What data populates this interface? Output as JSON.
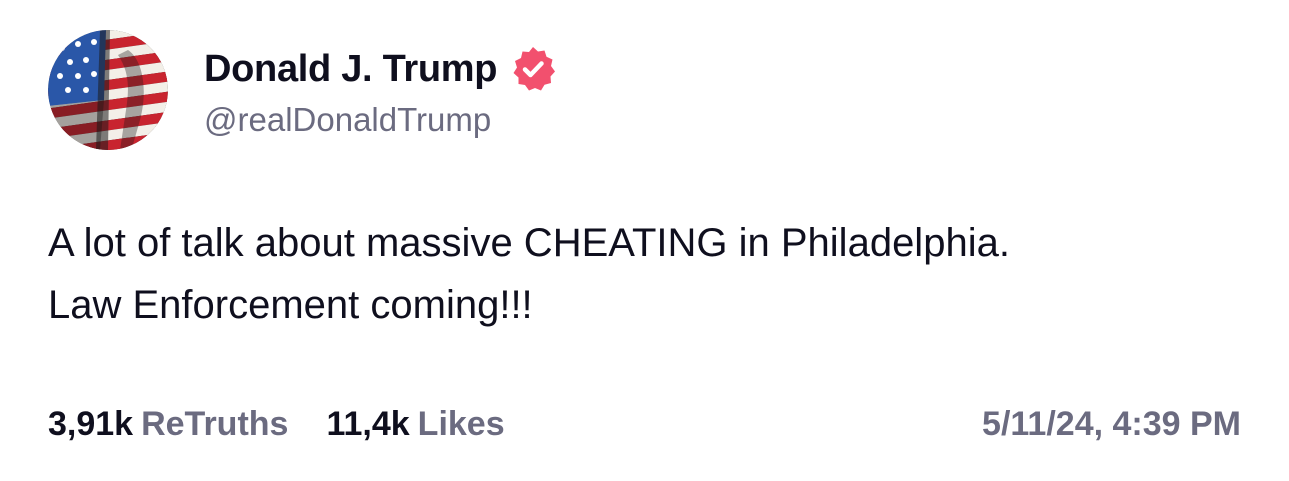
{
  "author": {
    "display_name": "Donald J. Trump",
    "handle": "@realDonaldTrump",
    "avatar_icon": "flag-portrait-avatar",
    "verified_icon": "verified-badge-icon",
    "verified_color": "#f2506e"
  },
  "post": {
    "lines": [
      "A lot of talk about massive CHEATING in Philadelphia.",
      "Law Enforcement coming!!!"
    ]
  },
  "stats": {
    "retruths_count": "3,91k",
    "retruths_label": "ReTruths",
    "likes_count": "11,4k",
    "likes_label": "Likes",
    "timestamp": "5/11/24, 4:39 PM"
  },
  "colors": {
    "text_primary": "#0f0f1e",
    "text_secondary": "#6b6b80",
    "flag_red": "#c8242f",
    "flag_blue": "#2a57a8"
  }
}
